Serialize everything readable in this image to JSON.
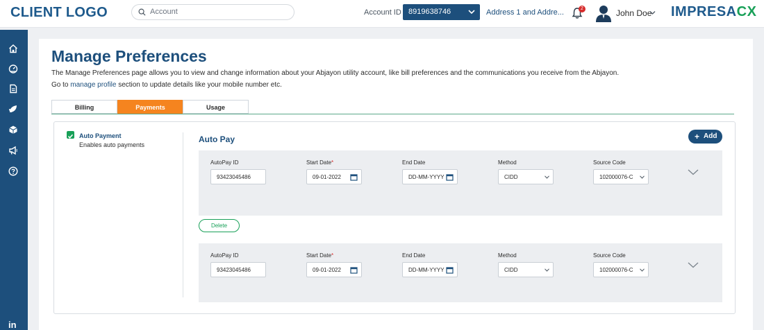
{
  "header": {
    "client_logo": "CLIENT LOGO",
    "search_placeholder": "Account",
    "account_id_label": "Account ID",
    "account_id_value": "8919638746",
    "address": "Address 1 and Addre...",
    "notifications_count": "2",
    "user_name": "John Doe",
    "brand_main": "IMPRESA",
    "brand_accent": "CX"
  },
  "sidenav": {
    "icons": [
      "home-icon",
      "dashboard-icon",
      "document-icon",
      "leaf-icon",
      "box-icon",
      "megaphone-icon",
      "help-icon"
    ],
    "footer": "in"
  },
  "page": {
    "title": "Manage Preferences",
    "description": "The Manage Preferences page allows you to view and change information about your Abjayon utility account, like bill preferences and the communications you receive from the Abjayon.",
    "goto_prefix": "Go to",
    "goto_link": "manage profile",
    "goto_suffix": "section to update details like your mobile number etc."
  },
  "tabs": [
    {
      "label": "Billing",
      "active": false
    },
    {
      "label": "Payments",
      "active": true
    },
    {
      "label": "Usage",
      "active": false
    }
  ],
  "autopay_toggle": {
    "label": "Auto Payment",
    "sublabel": "Enables auto payments",
    "checked": true
  },
  "autopay": {
    "title": "Auto Pay",
    "add_label": "Add",
    "delete_label": "Delete",
    "field_labels": {
      "id": "AutoPay ID",
      "start": "Start Date",
      "end": "End Date",
      "method": "Method",
      "source": "Source Code",
      "required_mark": "*"
    },
    "entries": [
      {
        "id": "93423045486",
        "start": "09-01-2022",
        "end": "DD-MM-YYYY",
        "method": "CIDD",
        "source": "102000076-C"
      },
      {
        "id": "93423045486",
        "start": "09-01-2022",
        "end": "DD-MM-YYYY",
        "method": "CIDD",
        "source": "102000076-C"
      }
    ]
  },
  "colors": {
    "primary": "#1d4f7c",
    "accent_orange": "#f5841f",
    "accent_green": "#18a058"
  }
}
